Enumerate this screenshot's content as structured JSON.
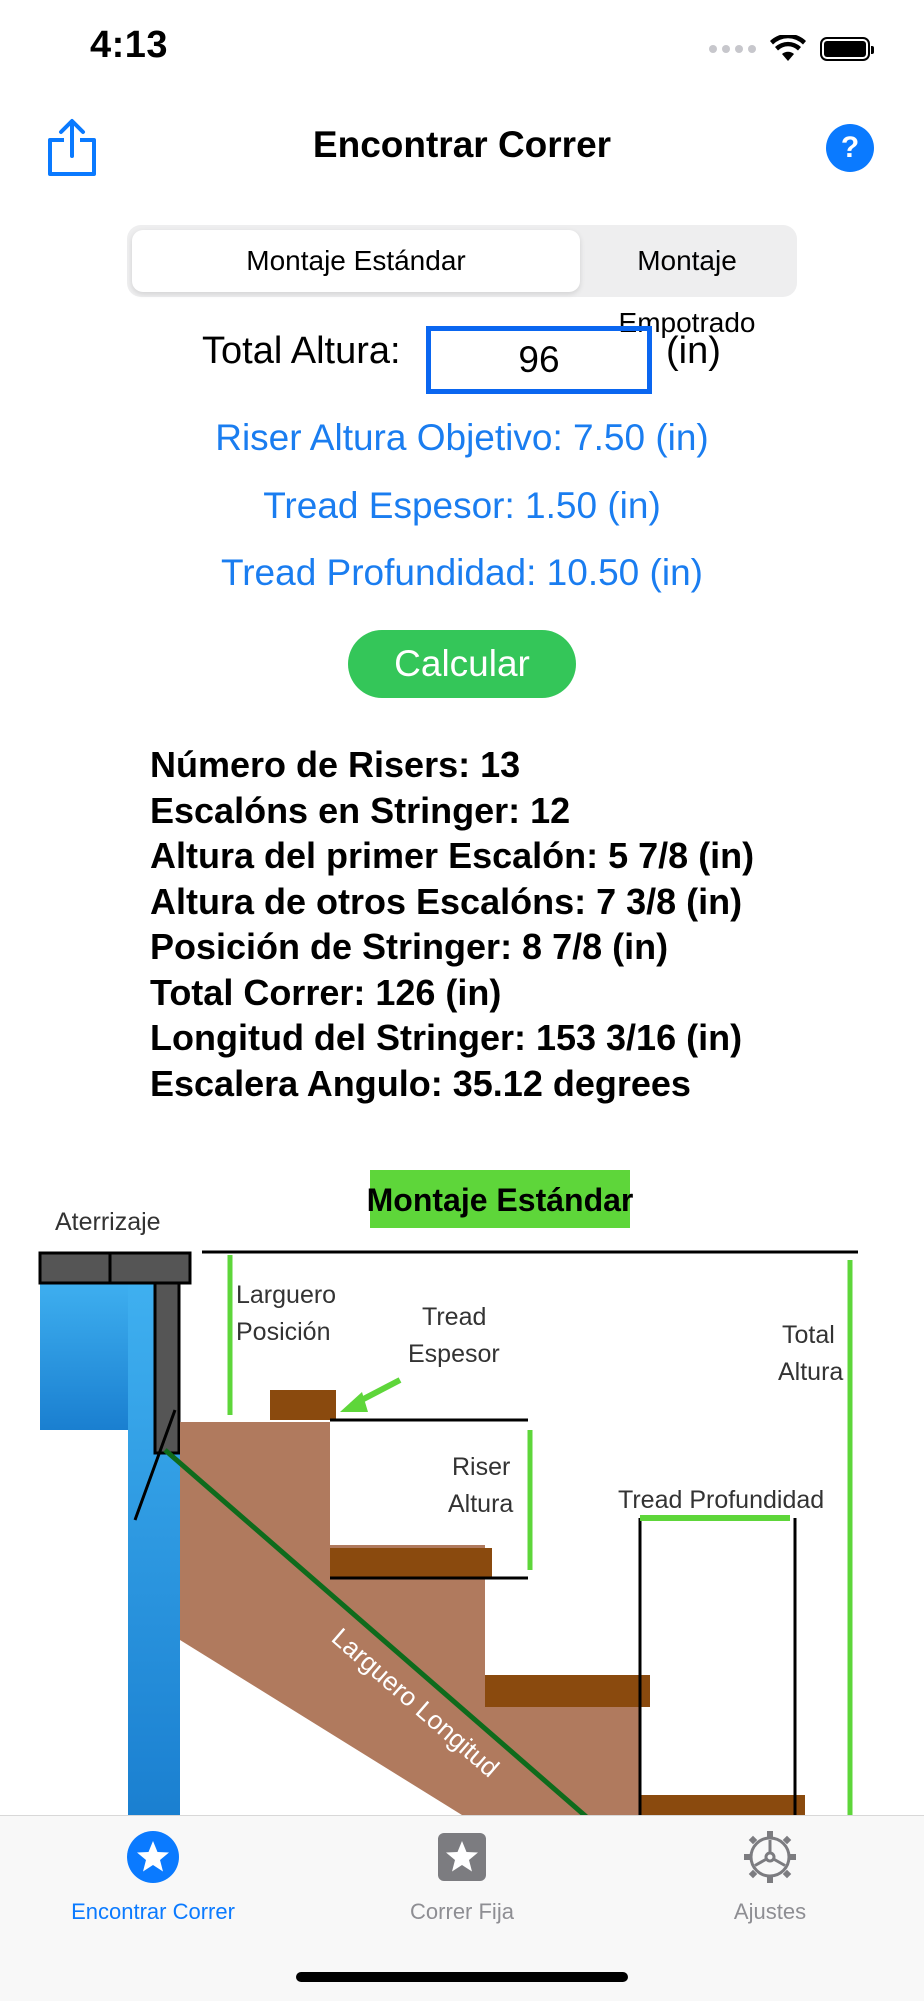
{
  "status": {
    "time": "4:13"
  },
  "nav": {
    "title": "Encontrar Correr",
    "help_label": "?"
  },
  "segments": {
    "selected": "Montaje Estándar",
    "other": "Montaje Empotrado"
  },
  "total_height": {
    "label": "Total Altura:",
    "value": "96",
    "unit": "(in)"
  },
  "params": [
    "Riser Altura Objetivo:  7.50 (in)",
    "Tread Espesor:  1.50 (in)",
    "Tread Profundidad:  10.50 (in)"
  ],
  "calculate_label": "Calcular",
  "results": [
    "Número de Risers: 13",
    "Escalóns en Stringer: 12",
    "Altura del primer Escalón: 5 7/8 (in)",
    "Altura de otros Escalóns: 7 3/8 (in)",
    "Posición de Stringer: 8 7/8 (in)",
    "Total Correr: 126 (in)",
    "Longitud del Stringer: 153 3/16 (in)",
    "Escalera Angulo: 35.12 degrees"
  ],
  "diagram": {
    "title": "Montaje Estándar",
    "landing": "Aterrizaje",
    "stringer_pos_1": "Larguero",
    "stringer_pos_2": "Posición",
    "tread_thick_1": "Tread",
    "tread_thick_2": "Espesor",
    "total_h_1": "Total",
    "total_h_2": "Altura",
    "riser_h_1": "Riser",
    "riser_h_2": "Altura",
    "tread_depth": "Tread Profundidad",
    "stringer_len": "Larguero Longitud"
  },
  "tabs": [
    {
      "label": "Encontrar Correr",
      "icon": "star-circle-icon",
      "active": true
    },
    {
      "label": "Correr Fija",
      "icon": "star-square-icon",
      "active": false
    },
    {
      "label": "Ajustes",
      "icon": "gear-icon",
      "active": false
    }
  ],
  "colors": {
    "accent": "#0a7aff",
    "green": "#34c659",
    "wood": "#b07a5e",
    "tread": "#8a4a0e",
    "wall": "#1a8fd8"
  }
}
